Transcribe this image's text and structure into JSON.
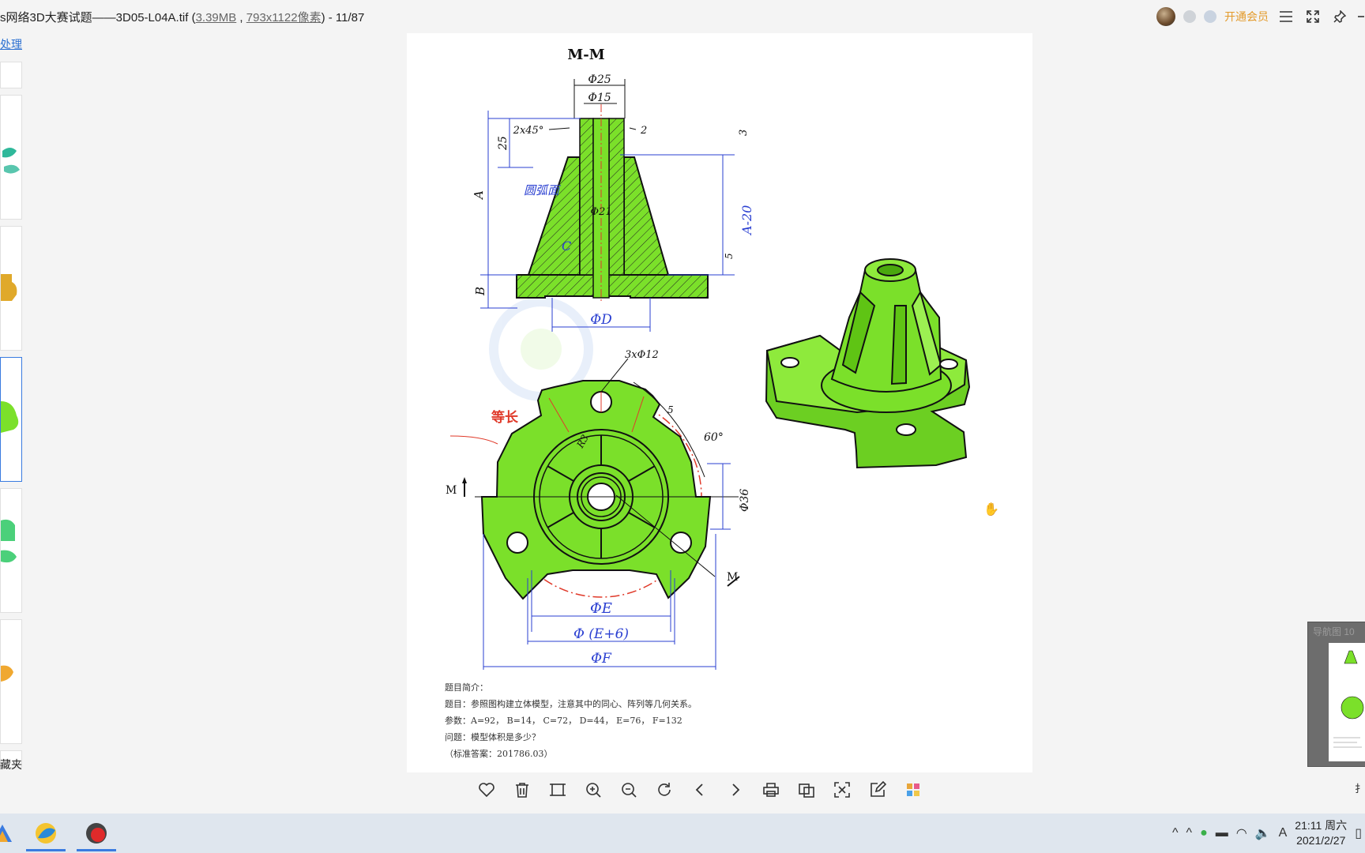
{
  "window": {
    "title_prefix": "s网络3D大赛试题——3D05-L04A.tif (",
    "file_size": "3.39MB",
    "separator": " , ",
    "dimensions": "793x1122像素",
    "title_suffix": ") - 11/87",
    "vip_label": "开通会员"
  },
  "sidebar": {
    "top_link": "处理",
    "bottom_label": "藏夹"
  },
  "drawing": {
    "section_title": "M-M",
    "dims": {
      "phi25": "Φ25",
      "phi15": "Φ15",
      "chamfer": "2x45°",
      "two": "2",
      "three": "3",
      "d25": "25",
      "a": "A",
      "arc_surface": "圆弧面",
      "phi21": "Φ21",
      "a_minus_20": "A-20",
      "c": "C",
      "five": "5",
      "b": "B",
      "phi_d": "ΦD",
      "holes": "3xΦ12",
      "equal_len": "等长",
      "r5": "5",
      "r3": "R3",
      "angle60": "60°",
      "phi36": "Φ36",
      "m_left": "M",
      "m_right": "M",
      "phi_e": "ΦE",
      "phi_e6": "Φ (E+6)",
      "phi_f": "ΦF"
    },
    "caption": {
      "line1": "题目简介：",
      "line2": "题目：参照图构建立体模型，注意其中的同心、阵列等几何关系。",
      "line3": "参数：A=92，  B=14，  C=72，  D=44，  E=76，  F=132",
      "line4": "问题：模型体积是多少？",
      "line5": "（标准答案：201786.03）"
    }
  },
  "navigator": {
    "label": "导航图 10"
  },
  "right_edge_label": "扌",
  "toolbar": {
    "buttons": [
      "favorite",
      "delete",
      "fit-window",
      "zoom-in",
      "zoom-out",
      "rotate",
      "previous",
      "next",
      "print",
      "convert",
      "screenshot",
      "edit",
      "apps"
    ]
  },
  "taskbar": {
    "time": "21:11 周六",
    "date": "2021/2/27",
    "ime": "A"
  },
  "colors": {
    "part_green": "#7be02a",
    "dimension_blue": "#2a3fd1",
    "annotation_red": "#e03a2a",
    "vip_orange": "#e39a2a",
    "link_blue": "#2a6fd1"
  }
}
